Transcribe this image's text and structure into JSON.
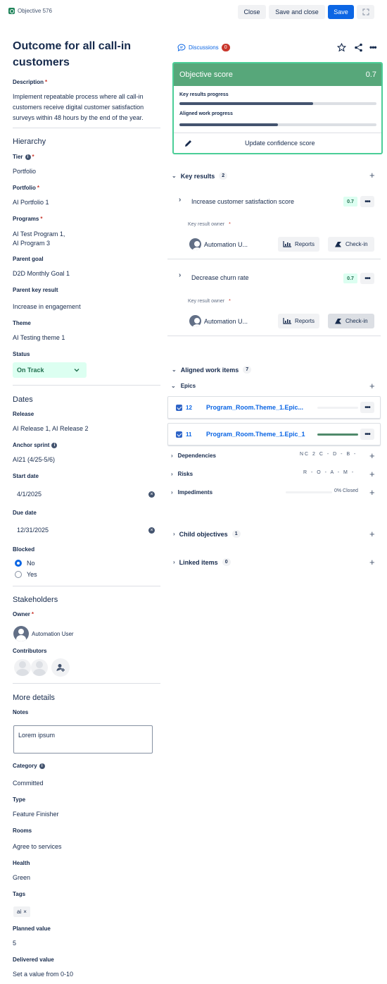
{
  "topbar": {
    "object_id": "Objective 576",
    "close_label": "Close",
    "save_close_label": "Save and close",
    "save_label": "Save"
  },
  "title": "Outcome for all call-in customers",
  "description": {
    "label": "Description",
    "text": "Implement repeatable process where all call-in customers receive digital customer satisfaction surveys within 48 hours by the end of the year."
  },
  "hierarchy": {
    "heading": "Hierarchy",
    "tier_label": "Tier",
    "tier_value": "Portfolio",
    "portfolio_label": "Portfolio",
    "portfolio_value": "AI Portfolio 1",
    "programs_label": "Programs",
    "programs_line1": "AI Test Program 1,",
    "programs_line2": "AI Program 3",
    "parent_goal_label": "Parent goal",
    "parent_goal_value": "D2D Monthly Goal 1",
    "parent_kr_label": "Parent key result",
    "parent_kr_value": "Increase in engagement",
    "theme_label": "Theme",
    "theme_value": "AI Testing theme 1",
    "status_label": "Status",
    "status_value": "On Track"
  },
  "dates": {
    "heading": "Dates",
    "release_label": "Release",
    "release_value": "AI Release 1,  AI Release 2",
    "anchor_label": "Anchor sprint",
    "anchor_value": "AI21 (4/25-5/6)",
    "start_label": "Start date",
    "start_value": "4/1/2025",
    "due_label": "Due date",
    "due_value": "12/31/2025",
    "blocked_label": "Blocked",
    "blocked_no": "No",
    "blocked_yes": "Yes"
  },
  "stakeholders": {
    "heading": "Stakeholders",
    "owner_label": "Owner",
    "owner_name": "Automation User",
    "contributors_label": "Contributors"
  },
  "more": {
    "heading": "More details",
    "notes_label": "Notes",
    "notes_value": "Lorem ipsum",
    "category_label": "Category",
    "category_value": "Committed",
    "type_label": "Type",
    "type_value": "Feature Finisher",
    "rooms_label": "Rooms",
    "rooms_value": "Agree to services",
    "health_label": "Health",
    "health_value": "Green",
    "tags_label": "Tags",
    "tag_value": "ai",
    "planned_label": "Planned value",
    "planned_value": "5",
    "delivered_label": "Delivered value",
    "delivered_placeholder": "Set a value from 0-10"
  },
  "discussions": {
    "label": "Discussions",
    "count": "0"
  },
  "score": {
    "title": "Objective score",
    "value": "0.7",
    "kr_progress_label": "Key results progress",
    "kr_progress": 0.68,
    "aligned_progress_label": "Aligned work progress",
    "aligned_progress": 0.5,
    "update_label": "Update confidence score"
  },
  "key_results": {
    "heading": "Key results",
    "count": "2",
    "items": [
      {
        "title": "Increase customer satisfaction score",
        "score": "0.7",
        "owner_label": "Key result owner",
        "owner": "Automation U...",
        "reports": "Reports",
        "checkin": "Check-in"
      },
      {
        "title": "Decrease churn rate",
        "score": "0.7",
        "owner_label": "Key result owner",
        "owner": "Automation U...",
        "reports": "Reports",
        "checkin": "Check-in"
      }
    ]
  },
  "aligned": {
    "heading": "Aligned work items",
    "count": "7",
    "epics_label": "Epics",
    "epics": [
      {
        "count": "12",
        "name": "Program_Room.Theme_1.Epic...",
        "progress": 0.0
      },
      {
        "count": "11",
        "name": "Program_Room.Theme_1.Epic_1",
        "progress": 1.0
      }
    ],
    "dependencies_label": "Dependencies",
    "dependencies_metric": "NC 2 C - D - B -",
    "risks_label": "Risks",
    "risks_metric": "R - O - A - M -",
    "impediments_label": "Impediments",
    "impediments_metric": "0% Closed"
  },
  "child_objectives": {
    "heading": "Child objectives",
    "count": "1"
  },
  "linked_items": {
    "heading": "Linked items",
    "count": "0"
  }
}
